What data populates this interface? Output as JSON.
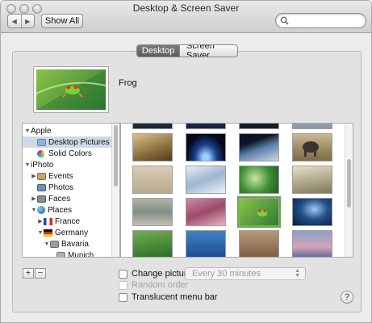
{
  "window": {
    "title": "Desktop & Screen Saver"
  },
  "toolbar": {
    "back": "◀",
    "forward": "▶",
    "show_all": "Show All",
    "search_placeholder": ""
  },
  "tabs": [
    {
      "label": "Desktop",
      "active": true
    },
    {
      "label": "Screen Saver",
      "active": false
    }
  ],
  "preview": {
    "name": "Frog"
  },
  "sources": [
    {
      "label": "Apple",
      "level": 0,
      "expanded": true,
      "icon": "none"
    },
    {
      "label": "Desktop Pictures",
      "level": 1,
      "selected": true,
      "icon": "folder-icon"
    },
    {
      "label": "Solid Colors",
      "level": 1,
      "icon": "color-wheel-icon"
    },
    {
      "label": "iPhoto",
      "level": 0,
      "expanded": true,
      "icon": "none"
    },
    {
      "label": "Events",
      "level": 1,
      "collapsed": true,
      "icon": "events-icon"
    },
    {
      "label": "Photos",
      "level": 1,
      "icon": "photos-icon"
    },
    {
      "label": "Faces",
      "level": 1,
      "collapsed": true,
      "icon": "faces-icon"
    },
    {
      "label": "Places",
      "level": 1,
      "expanded": true,
      "icon": "globe-icon"
    },
    {
      "label": "France",
      "level": 2,
      "collapsed": true,
      "icon": "flag-france-icon"
    },
    {
      "label": "Germany",
      "level": 2,
      "expanded": true,
      "icon": "flag-germany-icon"
    },
    {
      "label": "Bavaria",
      "level": 3,
      "expanded": true,
      "icon": "region-icon"
    },
    {
      "label": "Munich",
      "level": 4,
      "icon": "city-icon"
    }
  ],
  "options": {
    "change_picture": "Change picture:",
    "interval": "Every 30 minutes",
    "random_order": "Random order",
    "translucent_menu_bar": "Translucent menu bar"
  },
  "buttons": {
    "add": "+",
    "remove": "−",
    "help": "?"
  },
  "colors": {
    "selection_green": "#6aa843",
    "source_selection": "#d2d9e6"
  }
}
